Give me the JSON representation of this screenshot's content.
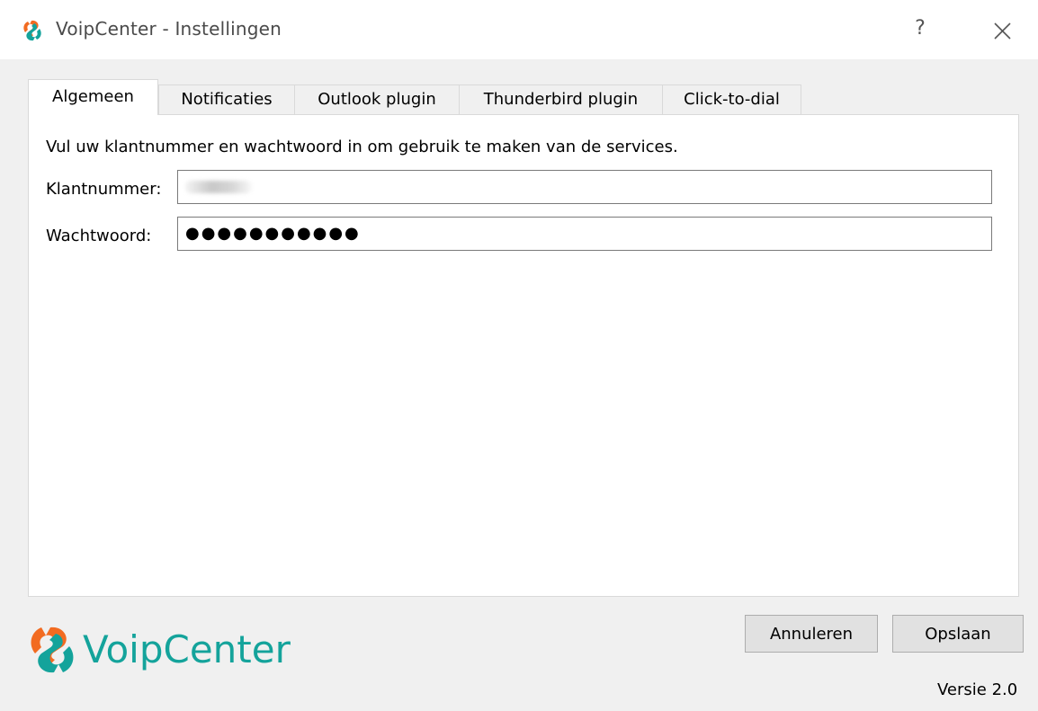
{
  "window": {
    "title": "VoipCenter - Instellingen",
    "help_label": "?",
    "close_label": "close"
  },
  "tabs": [
    {
      "label": "Algemeen",
      "active": true
    },
    {
      "label": "Notificaties",
      "active": false
    },
    {
      "label": "Outlook plugin",
      "active": false
    },
    {
      "label": "Thunderbird plugin",
      "active": false
    },
    {
      "label": "Click-to-dial",
      "active": false
    }
  ],
  "general": {
    "intro": "Vul uw klantnummer en wachtwoord in om gebruik te maken van de services.",
    "customer_label": "Klantnummer:",
    "customer_value": "",
    "password_label": "Wachtwoord:",
    "password_mask": "●●●●●●●●●●●"
  },
  "footer": {
    "brand": "VoipCenter",
    "cancel_label": "Annuleren",
    "save_label": "Opslaan",
    "version": "Versie 2.0"
  },
  "colors": {
    "brand_teal": "#14a39b",
    "brand_orange": "#f26b21",
    "button_bg": "#e1e1e1"
  },
  "icons": {
    "title_logo": "voipcenter-logo-icon",
    "close": "close-icon"
  }
}
